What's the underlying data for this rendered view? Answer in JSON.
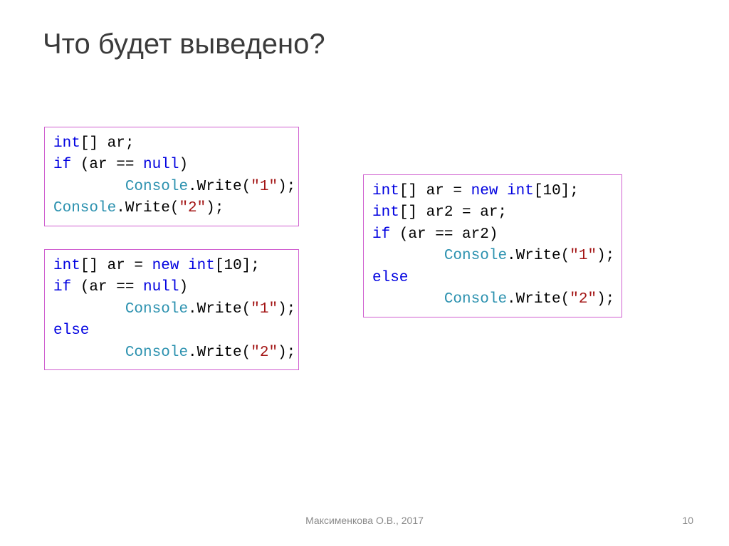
{
  "title": "Что будет выведено?",
  "footer": "Максименкова О.В., 2017",
  "page": "10",
  "code": {
    "box1": {
      "tokens": [
        {
          "t": "int",
          "c": "kw"
        },
        {
          "t": "[] ar;\n"
        },
        {
          "t": "if",
          "c": "kw"
        },
        {
          "t": " (ar == "
        },
        {
          "t": "null",
          "c": "kw"
        },
        {
          "t": ")\n"
        },
        {
          "t": "        "
        },
        {
          "t": "Console",
          "c": "type"
        },
        {
          "t": ".Write("
        },
        {
          "t": "\"1\"",
          "c": "str"
        },
        {
          "t": ");\n"
        },
        {
          "t": "Console",
          "c": "type"
        },
        {
          "t": ".Write("
        },
        {
          "t": "\"2\"",
          "c": "str"
        },
        {
          "t": ");"
        }
      ]
    },
    "box2": {
      "tokens": [
        {
          "t": "int",
          "c": "kw"
        },
        {
          "t": "[] ar = "
        },
        {
          "t": "new",
          "c": "kw"
        },
        {
          "t": " "
        },
        {
          "t": "int",
          "c": "kw"
        },
        {
          "t": "[10];\n"
        },
        {
          "t": "if",
          "c": "kw"
        },
        {
          "t": " (ar == "
        },
        {
          "t": "null",
          "c": "kw"
        },
        {
          "t": ")\n"
        },
        {
          "t": "        "
        },
        {
          "t": "Console",
          "c": "type"
        },
        {
          "t": ".Write("
        },
        {
          "t": "\"1\"",
          "c": "str"
        },
        {
          "t": ");\n"
        },
        {
          "t": "else",
          "c": "kw"
        },
        {
          "t": "\n"
        },
        {
          "t": "        "
        },
        {
          "t": "Console",
          "c": "type"
        },
        {
          "t": ".Write("
        },
        {
          "t": "\"2\"",
          "c": "str"
        },
        {
          "t": ");"
        }
      ]
    },
    "box3": {
      "tokens": [
        {
          "t": "int",
          "c": "kw"
        },
        {
          "t": "[] ar = "
        },
        {
          "t": "new",
          "c": "kw"
        },
        {
          "t": " "
        },
        {
          "t": "int",
          "c": "kw"
        },
        {
          "t": "[10];\n"
        },
        {
          "t": "int",
          "c": "kw"
        },
        {
          "t": "[] ar2 = ar;\n"
        },
        {
          "t": "if",
          "c": "kw"
        },
        {
          "t": " (ar == ar2)\n"
        },
        {
          "t": "        "
        },
        {
          "t": "Console",
          "c": "type"
        },
        {
          "t": ".Write("
        },
        {
          "t": "\"1\"",
          "c": "str"
        },
        {
          "t": ");\n"
        },
        {
          "t": "else",
          "c": "kw"
        },
        {
          "t": "\n"
        },
        {
          "t": "        "
        },
        {
          "t": "Console",
          "c": "type"
        },
        {
          "t": ".Write("
        },
        {
          "t": "\"2\"",
          "c": "str"
        },
        {
          "t": ");"
        }
      ]
    }
  }
}
